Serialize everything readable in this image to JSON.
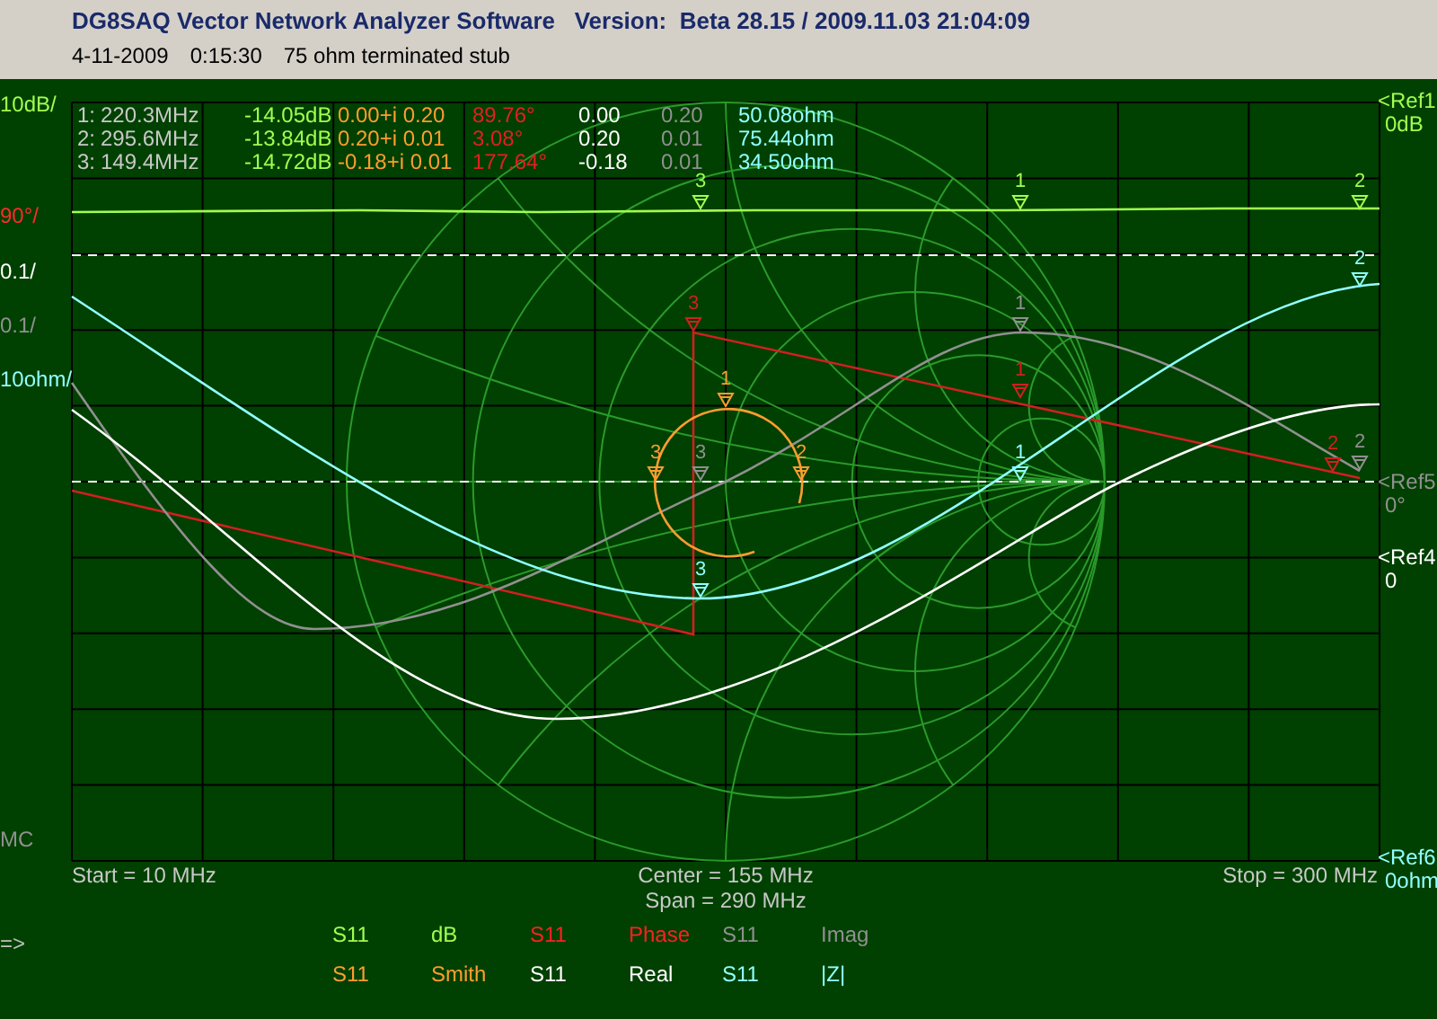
{
  "window": {
    "title": "DG8SAQ Vector Network Analyzer Software   Version:  Beta 28.15 / 2009.11.03 21:04:09"
  },
  "measurement": {
    "date": "4-11-2009",
    "time": "0:15:30",
    "description": "75 ohm terminated stub"
  },
  "marker_readout": [
    {
      "label": "1:",
      "frequency": "220.3MHz",
      "db": "-14.05dB",
      "smith": "0.00+i 0.20",
      "phase": "89.76°",
      "real": "0.00",
      "imag": "0.20",
      "z": "50.08ohm"
    },
    {
      "label": "2:",
      "frequency": "295.6MHz",
      "db": "-13.84dB",
      "smith": "0.20+i 0.01",
      "phase": "3.08°",
      "real": "0.20",
      "imag": "0.01",
      "z": "75.44ohm"
    },
    {
      "label": "3:",
      "frequency": "149.4MHz",
      "db": "-14.72dB",
      "smith": "-0.18+i 0.01",
      "phase": "177.64°",
      "real": "-0.18",
      "imag": "0.01",
      "z": "34.50ohm"
    }
  ],
  "scale_labels": [
    {
      "kind": "db",
      "text": "10dB/"
    },
    {
      "kind": "phase",
      "text": "90°/"
    },
    {
      "kind": "real",
      "text": "0.1/"
    },
    {
      "kind": "imag",
      "text": "0.1/"
    },
    {
      "kind": "z",
      "text": "10ohm/"
    }
  ],
  "reference_labels": [
    {
      "kind": "db",
      "name": "<Ref1",
      "value": "0dB"
    },
    {
      "kind": "imag",
      "name": "<Ref5",
      "value": "0°"
    },
    {
      "kind": "real",
      "name": "<Ref4",
      "value": "0"
    },
    {
      "kind": "z",
      "name": "<Ref6",
      "value": "0ohm"
    }
  ],
  "traces": [
    {
      "kind": "db",
      "parameter": "S11",
      "format": "dB",
      "markers": [
        "3",
        "1",
        "2"
      ]
    },
    {
      "kind": "phase",
      "parameter": "S11",
      "format": "Phase",
      "markers": [
        "3",
        "1",
        "2"
      ]
    },
    {
      "kind": "imag",
      "parameter": "S11",
      "format": "Imag",
      "markers": [
        "3",
        "1",
        "2"
      ]
    },
    {
      "kind": "smith",
      "parameter": "S11",
      "format": "Smith",
      "markers": [
        "1",
        "2",
        "3"
      ]
    },
    {
      "kind": "real",
      "parameter": "S11",
      "format": "Real"
    },
    {
      "kind": "z",
      "parameter": "S11",
      "format": "|Z|",
      "markers": [
        "3",
        "1",
        "2"
      ]
    }
  ],
  "mode_label": "MC",
  "cursor_label": "=>",
  "sweep": {
    "start": "Start = 10 MHz",
    "center": "Center = 155 MHz",
    "span": "Span = 290 MHz",
    "stop": "Stop = 300 MHz"
  }
}
